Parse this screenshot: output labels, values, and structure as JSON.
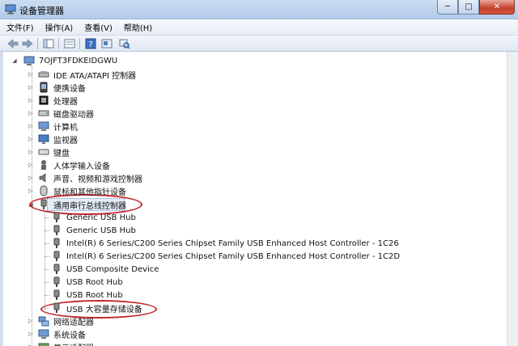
{
  "window": {
    "title": "设备管理器",
    "min": "─",
    "max": "□",
    "close": "✕"
  },
  "menu": [
    "文件(F)",
    "操作(A)",
    "查看(V)",
    "帮助(H)"
  ],
  "tree": {
    "root": "7OJFT3FDKEIDGWU",
    "categories": [
      {
        "label": "IDE ATA/ATAPI 控制器",
        "icon": "ide-controller-icon"
      },
      {
        "label": "便携设备",
        "icon": "portable-device-icon"
      },
      {
        "label": "处理器",
        "icon": "processor-icon"
      },
      {
        "label": "磁盘驱动器",
        "icon": "disk-drive-icon"
      },
      {
        "label": "计算机",
        "icon": "computer-icon"
      },
      {
        "label": "监视器",
        "icon": "monitor-icon"
      },
      {
        "label": "键盘",
        "icon": "keyboard-icon"
      },
      {
        "label": "人体学输入设备",
        "icon": "hid-icon"
      },
      {
        "label": "声音、视频和游戏控制器",
        "icon": "sound-icon"
      },
      {
        "label": "鼠标和其他指针设备",
        "icon": "mouse-icon"
      }
    ],
    "usb_category": "通用串行总线控制器",
    "usb_children": [
      "Generic USB Hub",
      "Generic USB Hub",
      "Intel(R) 6 Series/C200 Series Chipset Family USB Enhanced Host Controller - 1C26",
      "Intel(R) 6 Series/C200 Series Chipset Family USB Enhanced Host Controller - 1C2D",
      "USB Composite Device",
      "USB Root Hub",
      "USB Root Hub",
      "USB 大容量存储设备"
    ],
    "after": [
      {
        "label": "网络适配器",
        "icon": "network-adapter-icon"
      },
      {
        "label": "系统设备",
        "icon": "system-device-icon"
      },
      {
        "label": "显示适配器",
        "icon": "display-adapter-icon"
      }
    ]
  },
  "colors": {
    "highlight": "#c0272d",
    "titlebar": "#b9cfea"
  }
}
